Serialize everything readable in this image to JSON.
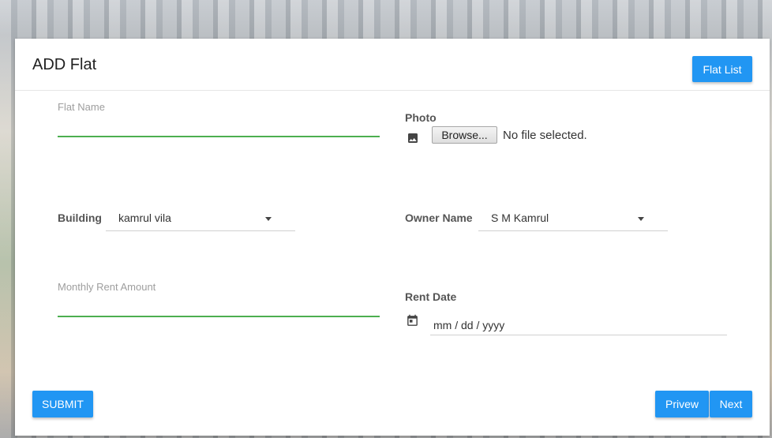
{
  "header": {
    "title": "ADD Flat",
    "flat_list_label": "Flat List"
  },
  "form": {
    "flat_name": {
      "label": "Flat Name",
      "value": ""
    },
    "photo": {
      "label": "Photo",
      "browse_label": "Browse...",
      "file_status": "No file selected."
    },
    "building": {
      "label": "Building",
      "selected": "kamrul vila"
    },
    "owner_name": {
      "label": "Owner Name",
      "selected": "S M Kamrul"
    },
    "monthly_rent": {
      "label": "Monthly Rent Amount",
      "value": ""
    },
    "rent_date": {
      "label": "Rent Date",
      "placeholder": "mm / dd / yyyy"
    }
  },
  "footer": {
    "submit_label": "SUBMIT",
    "preview_label": "Privew",
    "next_label": "Next"
  },
  "colors": {
    "primary": "#2196f3",
    "focus_underline": "#4caf50"
  },
  "icons": {
    "photo": "image-icon",
    "date": "calendar-icon",
    "dropdown": "caret-down-icon"
  }
}
